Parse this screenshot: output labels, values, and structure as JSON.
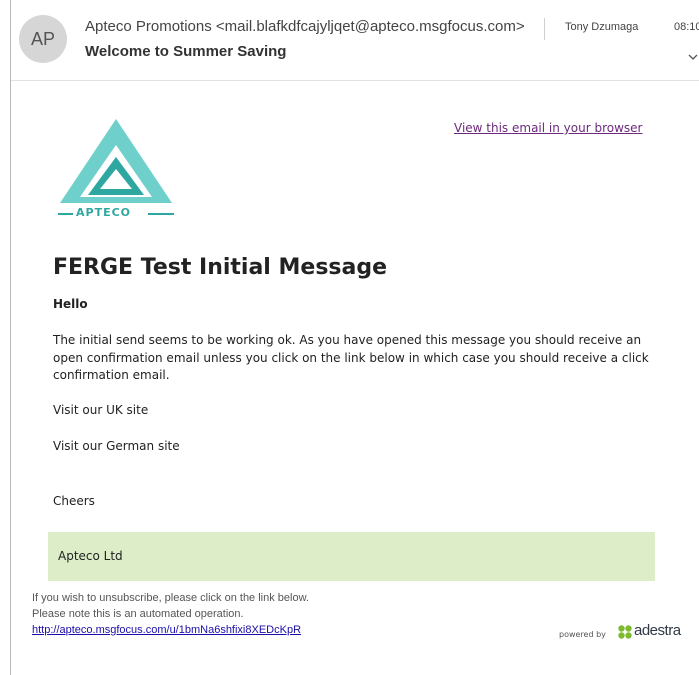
{
  "header": {
    "avatar_initials": "AP",
    "sender": "Apteco Promotions <mail.blafkdfcajyljqet@apteco.msgfocus.com>",
    "subject": "Welcome to Summer Saving",
    "to": "Tony Dzumaga",
    "time": "08:10",
    "expand_icon": "chevron-down-icon"
  },
  "email": {
    "view_in_browser": "View this email in your browser",
    "logo": {
      "text": "APTECO",
      "color": "#2fa7a1"
    },
    "title": "FERGE Test Initial Message",
    "greeting": "Hello",
    "paragraph": "The initial send seems to be working ok. As you have opened this message you should receive an open confirmation email unless you click on the link below in which case you should receive a click confirmation email.",
    "uk_site": "Visit our UK site",
    "german_site": "Visit our German site",
    "signoff": "Cheers",
    "company": "Apteco Ltd",
    "footer_color": "#dcedc8"
  },
  "footer": {
    "unsubscribe_line1": "If you wish to unsubscribe, please click on the link below.",
    "unsubscribe_line2": "Please note this is an automated operation.",
    "unsubscribe_link": "http://apteco.msgfocus.com/u/1bmNa6shfixi8XEDcKpR",
    "powered_by": "powered by",
    "brand": "adestra",
    "brand_color": "#7dbb2f"
  }
}
